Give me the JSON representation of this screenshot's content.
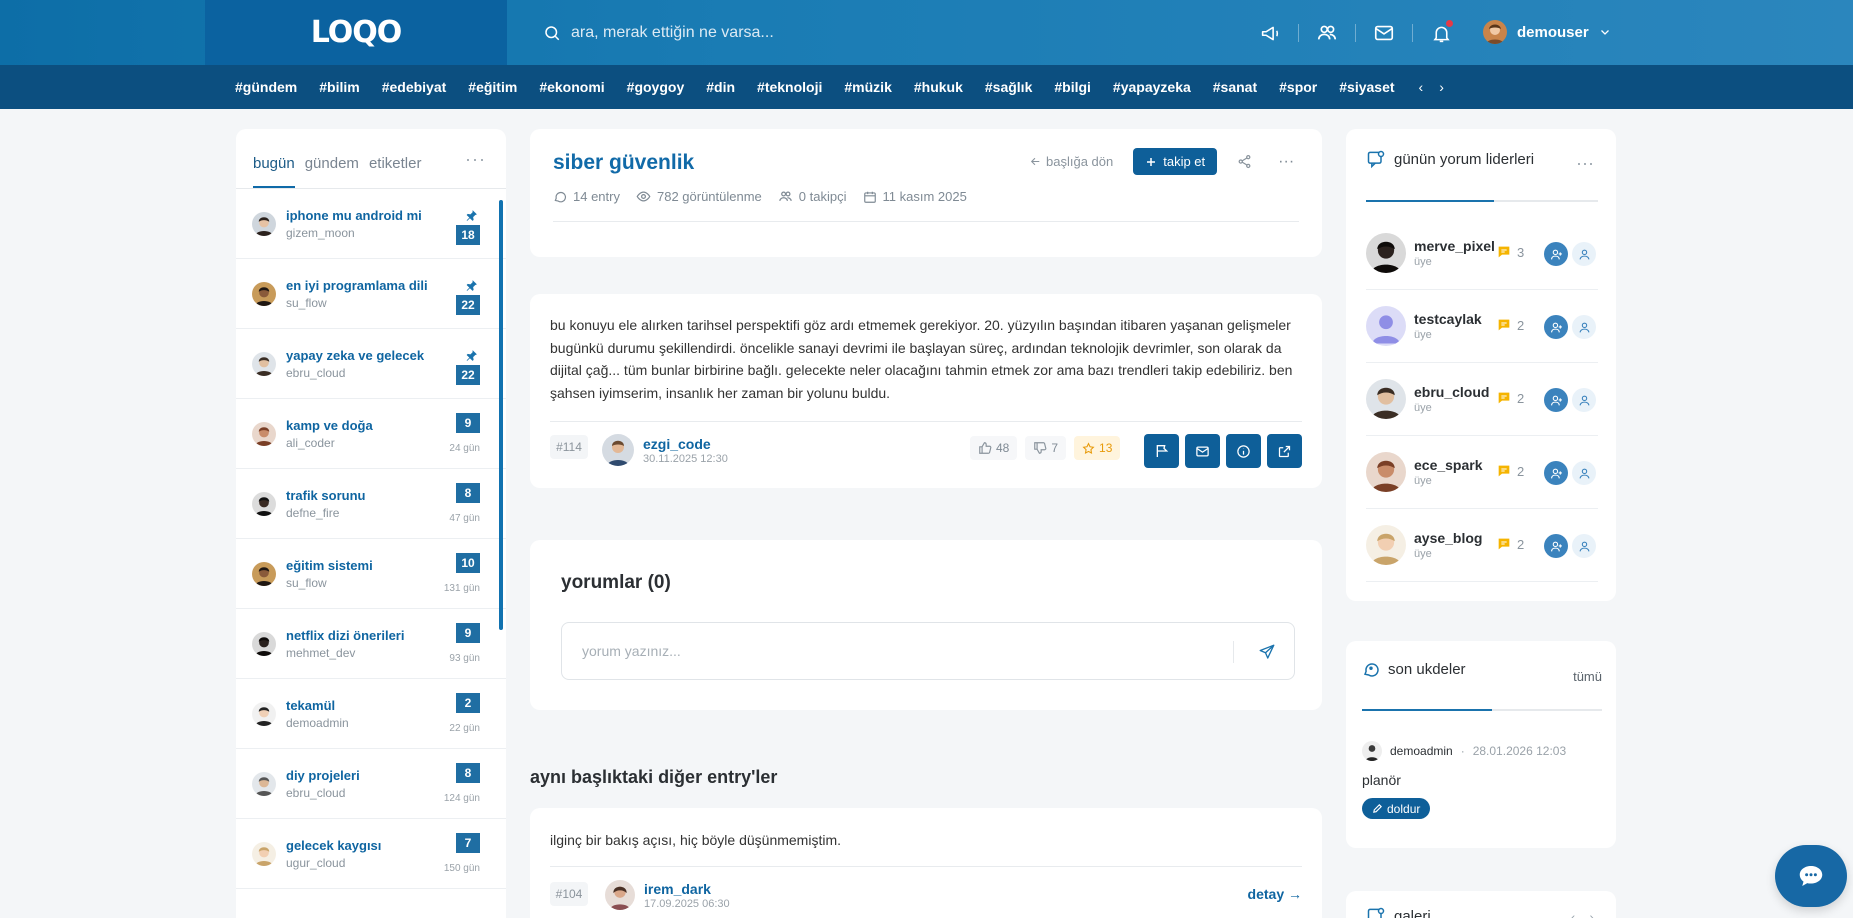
{
  "header": {
    "logo": "LOQO",
    "search_placeholder": "ara, merak ettiğin ne varsa...",
    "username": "demouser",
    "icons": [
      "megaphone-icon",
      "users-icon",
      "mail-icon",
      "bell-icon"
    ],
    "colors": {
      "primary": "#0e5f99",
      "tagbar": "#0c4f80",
      "accent": "#f5b400"
    }
  },
  "tags": [
    "#gündem",
    "#bilim",
    "#edebiyat",
    "#eğitim",
    "#ekonomi",
    "#goygoy",
    "#din",
    "#teknoloji",
    "#müzik",
    "#hukuk",
    "#sağlık",
    "#bilgi",
    "#yapayzeka",
    "#sanat",
    "#spor",
    "#siyaset"
  ],
  "tag_nav": {
    "prev": "‹",
    "next": "›"
  },
  "left": {
    "tabs": [
      "bugün",
      "gündem",
      "etiketler"
    ],
    "items": [
      {
        "title": "iphone mu android mi",
        "user": "gizem_moon",
        "count": "18",
        "days": "",
        "pinned": true
      },
      {
        "title": "en iyi programlama dili",
        "user": "su_flow",
        "count": "22",
        "days": "",
        "pinned": true
      },
      {
        "title": "yapay zeka ve gelecek",
        "user": "ebru_cloud",
        "count": "22",
        "days": "",
        "pinned": true
      },
      {
        "title": "kamp ve doğa",
        "user": "ali_coder",
        "count": "9",
        "days": "24 gün",
        "pinned": false
      },
      {
        "title": "trafik sorunu",
        "user": "defne_fire",
        "count": "8",
        "days": "47 gün",
        "pinned": false
      },
      {
        "title": "eğitim sistemi",
        "user": "su_flow",
        "count": "10",
        "days": "131 gün",
        "pinned": false
      },
      {
        "title": "netflix dizi önerileri",
        "user": "mehmet_dev",
        "count": "9",
        "days": "93 gün",
        "pinned": false
      },
      {
        "title": "tekamül",
        "user": "demoadmin",
        "count": "2",
        "days": "22 gün",
        "pinned": false
      },
      {
        "title": "diy projeleri",
        "user": "ebru_cloud",
        "count": "8",
        "days": "124 gün",
        "pinned": false
      },
      {
        "title": "gelecek kaygısı",
        "user": "ugur_cloud",
        "count": "7",
        "days": "150 gün",
        "pinned": false
      }
    ]
  },
  "topic": {
    "title": "siber güvenlik",
    "back_label": "başlığa dön",
    "follow_label": "takip et",
    "entries": "14 entry",
    "views": "782 görüntülenme",
    "followers": "0 takipçi",
    "date": "11 kasım 2025"
  },
  "entry": {
    "text": "bu konuyu ele alırken tarihsel perspektifi göz ardı etmemek gerekiyor. 20. yüzyılın başından itibaren yaşanan gelişmeler bugünkü durumu şekillendirdi. öncelikle sanayi devrimi ile başlayan süreç, ardından teknolojik devrimler, son olarak da dijital çağ... tüm bunlar birbirine bağlı. gelecekte neler olacağını tahmin etmek zor ama bazı trendleri takip edebiliriz. ben şahsen iyimserim, insanlık her zaman bir yolunu buldu.",
    "id": "#114",
    "author": "ezgi_code",
    "date": "30.11.2025 12:30",
    "likes": "48",
    "dislikes": "7",
    "favorites": "13"
  },
  "comments": {
    "title": "yorumlar (0)",
    "placeholder": "yorum yazınız..."
  },
  "other": {
    "title": "aynı başlıktaki diğer entry'ler",
    "text": "ilginç bir bakış açısı, hiç böyle düşünmemiştim.",
    "id": "#104",
    "author": "irem_dark",
    "date": "17.09.2025 06:30",
    "more": "detay →"
  },
  "leaders": {
    "title": "günün yorum liderleri",
    "rows": [
      {
        "name": "merve_pixel",
        "role": "üye",
        "count": "3"
      },
      {
        "name": "testcaylak",
        "role": "üye",
        "count": "2"
      },
      {
        "name": "ebru_cloud",
        "role": "üye",
        "count": "2"
      },
      {
        "name": "ece_spark",
        "role": "üye",
        "count": "2"
      },
      {
        "name": "ayse_blog",
        "role": "üye",
        "count": "2"
      }
    ]
  },
  "ukde": {
    "title": "son ukdeler",
    "all": "tümü",
    "user": "demoadmin",
    "sep": "·",
    "date": "28.01.2026 12:03",
    "word": "planör",
    "button": "doldur"
  },
  "gallery": {
    "title": "galeri"
  }
}
